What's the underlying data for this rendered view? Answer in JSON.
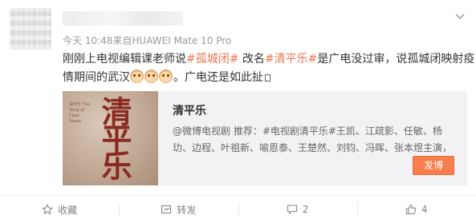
{
  "post": {
    "meta_time": "今天 10:48",
    "meta_source": "来自HUAWEI Mate 10 Pro",
    "text": {
      "l1_a": "刚刚上电视编辑课老师说",
      "l1_tag1": "#孤城闭#",
      "l1_b": " 改名",
      "l1_tag2": "#清平乐#",
      "l1_c": "是广电没过审，说孤城闭映射疫",
      "l2_a": "情期间的武汉",
      "l2_b": "。广电还是如此扯"
    }
  },
  "share_card": {
    "poster_title": "清平乐",
    "poster_small": "清平乐 The Song of Clear Peace",
    "title": "清平乐",
    "desc_l1": "@微博电视剧 推荐：#电视剧清平乐#王凯、江疏影、任敏、杨",
    "desc_l2": "玏、边程、叶祖新、喻恩泰、王楚然、刘钧、冯晖、张本煜主演，",
    "button": "发博"
  },
  "actions": {
    "collect": "收藏",
    "forward": "转发",
    "comment": "2",
    "like": "4"
  },
  "colors": {
    "link": "#eb7350",
    "button": "#f87e4d"
  }
}
